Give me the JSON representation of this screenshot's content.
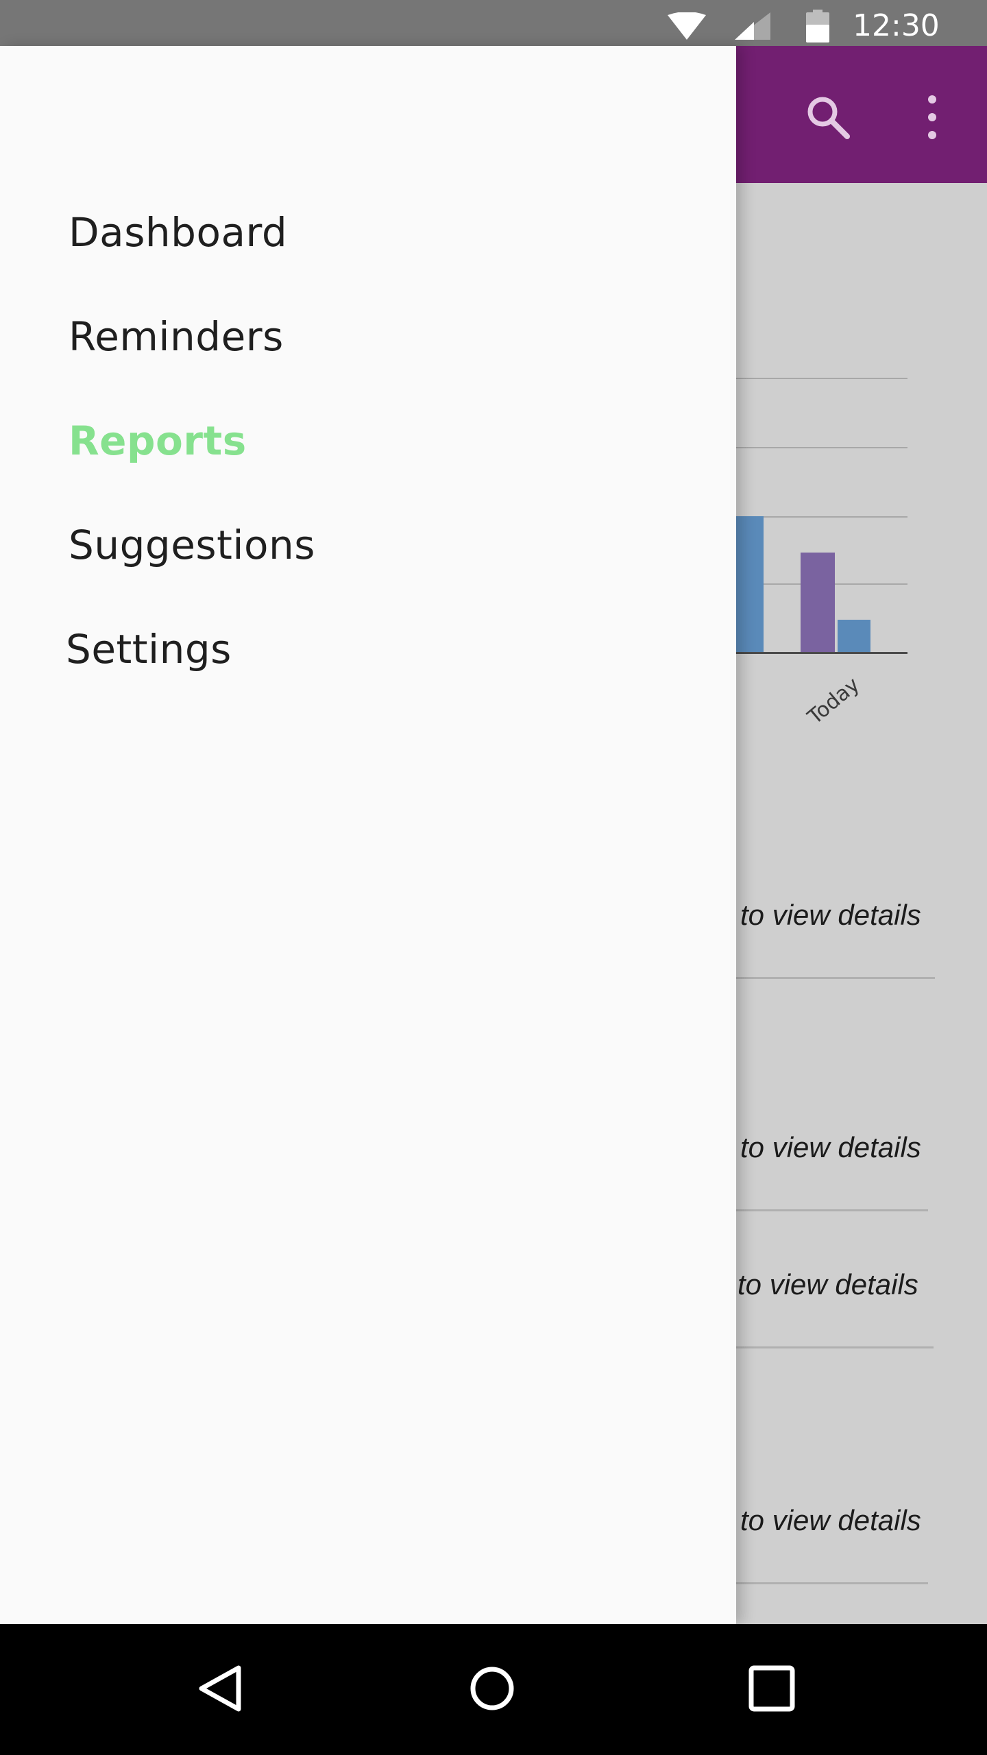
{
  "status_bar": {
    "time": "12:30",
    "icons": [
      "wifi-icon",
      "cell-signal-icon",
      "battery-icon"
    ]
  },
  "app_bar": {
    "color": "#721f71",
    "icons": [
      "search-icon",
      "more-vert-icon"
    ]
  },
  "drawer": {
    "items": [
      {
        "label": "Dashboard",
        "active": false
      },
      {
        "label": "Reminders",
        "active": false
      },
      {
        "label": "Reports",
        "active": true
      },
      {
        "label": "Suggestions",
        "active": false
      },
      {
        "label": "Settings",
        "active": false
      }
    ],
    "active_color": "#86e18e"
  },
  "background_content": {
    "chart_tick_label": "Today",
    "detail_link_text": "to view details",
    "series_colors": [
      "#7a63a0",
      "#5a8ab9"
    ]
  },
  "nav_bar": {
    "icons": [
      "back-icon",
      "home-icon",
      "recents-icon"
    ]
  }
}
